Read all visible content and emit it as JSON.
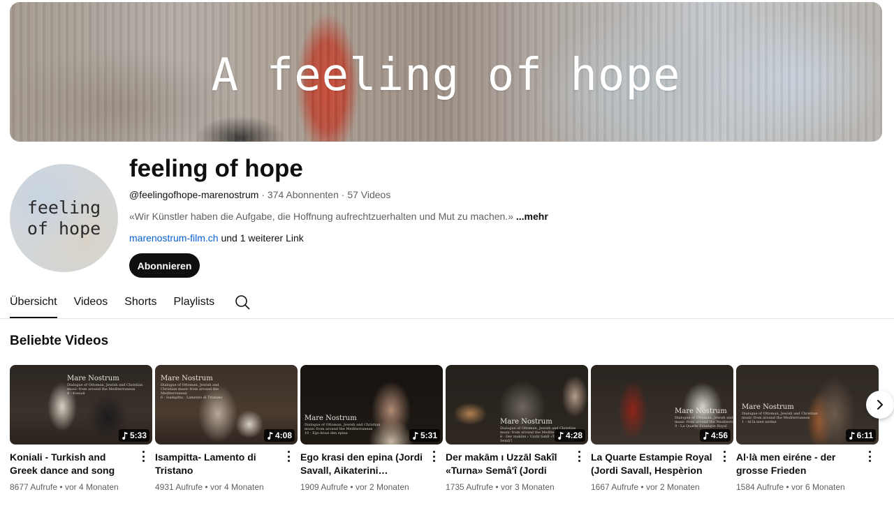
{
  "banner": {
    "text": "A feeling of hope"
  },
  "avatar": {
    "line1": "feeling",
    "line2": "of hope"
  },
  "channel": {
    "name": "feeling of hope",
    "handle": "@feelingofhope-marenostrum",
    "subscribers": "374 Abonnenten",
    "video_count": "57 Videos",
    "separator": "·",
    "description": "«Wir Künstler haben die Aufgabe, die Hoffnung aufrechtzuerhalten und Mut zu machen.»",
    "more_label": "...mehr",
    "link_text": "marenostrum-film.ch",
    "link_suffix": " und 1 weiterer Link",
    "subscribe_label": "Abonnieren"
  },
  "tabs": [
    {
      "label": "Übersicht",
      "active": true
    },
    {
      "label": "Videos",
      "active": false
    },
    {
      "label": "Shorts",
      "active": false
    },
    {
      "label": "Playlists",
      "active": false
    }
  ],
  "section": {
    "title": "Beliebte Videos"
  },
  "videos": [
    {
      "title": "Koniali - Turkish and Greek dance and song",
      "views": "8677 Aufrufe",
      "age": "vor 4 Monaten",
      "duration": "5:33",
      "thumb_title": "Mare Nostrum",
      "thumb_sub": "Dialogue of Ottoman, Jewish and Christian music from around the Mediterranean",
      "thumb_track": "4 - Koniali"
    },
    {
      "title": "Isampitta- Lamento di Tristano",
      "views": "4931 Aufrufe",
      "age": "vor 4 Monaten",
      "duration": "4:08",
      "thumb_title": "Mare Nostrum",
      "thumb_sub": "Dialogue of Ottoman, Jewish and Christian music from around the Mediterranean",
      "thumb_track": "6 - Isampitta - Lamento di Tristano"
    },
    {
      "title": "Ego krasi den epina (Jordi Savall, Aikaterini…",
      "views": "1909 Aufrufe",
      "age": "vor 2 Monaten",
      "duration": "5:31",
      "thumb_title": "Mare Nostrum",
      "thumb_sub": "Dialogue of Ottoman, Jewish and Christian music from around the Mediterranean",
      "thumb_track": "10 - Ego krasi den epina"
    },
    {
      "title": "Der makām ı Uzzāl Sakîl «Turna» Semâ'î (Jordi Saval…",
      "views": "1735 Aufrufe",
      "age": "vor 3 Monaten",
      "duration": "4:28",
      "thumb_title": "Mare Nostrum",
      "thumb_sub": "Dialogue of Ottoman, Jewish and Christian music from around the Mediterranean",
      "thumb_track": "8 - Der makām ı Uzzāl Sakîl «Turna» Semâ'î"
    },
    {
      "title": "La Quarte Estampie Royal (Jordi Savall, Hespèrion XXI…",
      "views": "1667 Aufrufe",
      "age": "vor 2 Monaten",
      "duration": "4:56",
      "thumb_title": "Mare Nostrum",
      "thumb_sub": "Dialogue of Ottoman, Jewish and Christian music from around the Mediterranean",
      "thumb_track": "9 - La Quarte Estampie Royal"
    },
    {
      "title": "Al·là men eiréne - der grosse Frieden",
      "views": "1584 Aufrufe",
      "age": "vor 6 Monaten",
      "duration": "6:11",
      "thumb_title": "Mare Nostrum",
      "thumb_sub": "Dialogue of Ottoman, Jewish and Christian music from around the Mediterranean",
      "thumb_track": "1 - Al·là men eiréne"
    }
  ],
  "meta_separator": "•",
  "icons": {
    "search": "search-icon",
    "next": "chevron-right-icon",
    "shorts_note": "music-note-icon",
    "menu": "more-vertical-icon"
  }
}
